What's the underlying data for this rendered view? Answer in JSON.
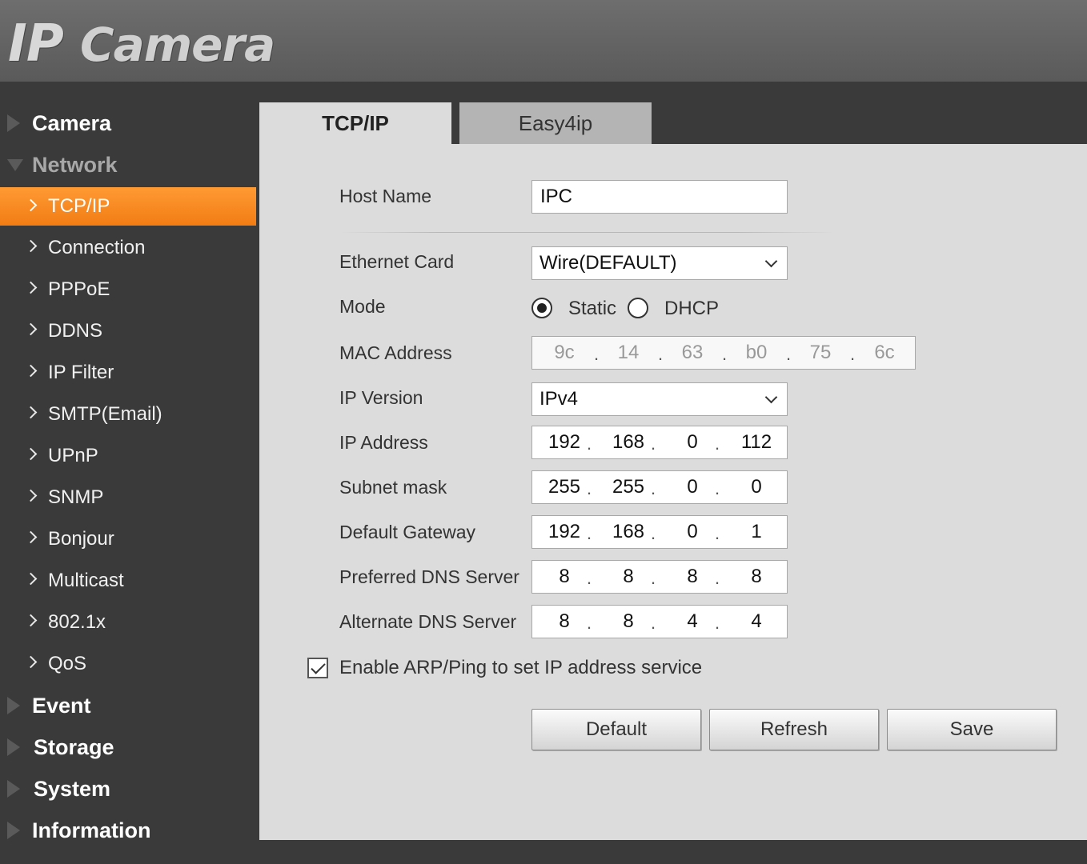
{
  "header": {
    "logo_part1": "IP",
    "logo_part2": "Camera"
  },
  "sidebar": {
    "sections_top": [
      {
        "label": "Camera"
      },
      {
        "label": "Network"
      }
    ],
    "network_items": [
      {
        "label": "TCP/IP"
      },
      {
        "label": "Connection"
      },
      {
        "label": "PPPoE"
      },
      {
        "label": "DDNS"
      },
      {
        "label": "IP Filter"
      },
      {
        "label": "SMTP(Email)"
      },
      {
        "label": "UPnP"
      },
      {
        "label": "SNMP"
      },
      {
        "label": "Bonjour"
      },
      {
        "label": "Multicast"
      },
      {
        "label": "802.1x"
      },
      {
        "label": "QoS"
      }
    ],
    "sections_bottom": [
      {
        "label": "Event"
      },
      {
        "label": "Storage"
      },
      {
        "label": "System"
      },
      {
        "label": "Information"
      }
    ]
  },
  "tabs": [
    {
      "label": "TCP/IP"
    },
    {
      "label": "Easy4ip"
    }
  ],
  "form": {
    "host_name": {
      "label": "Host Name",
      "value": "IPC"
    },
    "ethernet_card": {
      "label": "Ethernet Card",
      "value": "Wire(DEFAULT)"
    },
    "mode": {
      "label": "Mode",
      "option_static": "Static",
      "option_dhcp": "DHCP",
      "selected": "Static"
    },
    "mac_address": {
      "label": "MAC Address",
      "octets": [
        "9c",
        "14",
        "63",
        "b0",
        "75",
        "6c"
      ]
    },
    "ip_version": {
      "label": "IP Version",
      "value": "IPv4"
    },
    "ip_address": {
      "label": "IP Address",
      "octets": [
        "192",
        "168",
        "0",
        "112"
      ]
    },
    "subnet_mask": {
      "label": "Subnet mask",
      "octets": [
        "255",
        "255",
        "0",
        "0"
      ]
    },
    "default_gateway": {
      "label": "Default Gateway",
      "octets": [
        "192",
        "168",
        "0",
        "1"
      ]
    },
    "preferred_dns": {
      "label": "Preferred DNS Server",
      "octets": [
        "8",
        "8",
        "8",
        "8"
      ]
    },
    "alternate_dns": {
      "label": "Alternate DNS Server",
      "octets": [
        "8",
        "8",
        "4",
        "4"
      ]
    },
    "arp_ping": {
      "label": "Enable ARP/Ping to set IP address service",
      "checked": true
    }
  },
  "buttons": {
    "default": "Default",
    "refresh": "Refresh",
    "save": "Save"
  },
  "colors": {
    "accent": "#f7861f",
    "panel": "#dcdcdc",
    "sidebar_bg": "#3a3a3a"
  }
}
